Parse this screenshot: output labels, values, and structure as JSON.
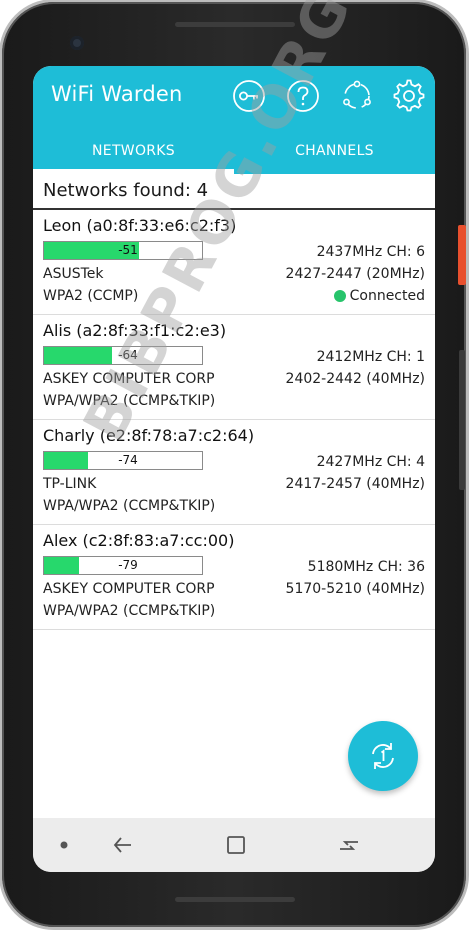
{
  "app": {
    "title": "WiFi Warden",
    "accent_color": "#1ebdd7",
    "toolbar_icons": [
      "key-icon",
      "help-icon",
      "share-icon",
      "settings-icon"
    ]
  },
  "tabs": [
    {
      "label": "NETWORKS",
      "selected": true
    },
    {
      "label": "CHANNELS",
      "selected": false
    }
  ],
  "summary": {
    "networks_found": "Networks found: 4"
  },
  "networks": [
    {
      "name": "Leon (a0:8f:33:e6:c2:f3)",
      "signal": "-51",
      "signal_fill": 0.6,
      "vendor": "ASUSTek",
      "security": "WPA2 (CCMP)",
      "frequency": "2437MHz  CH: 6",
      "range": "2427-2447 (20MHz)",
      "status": "Connected",
      "status_color": "#27c46b"
    },
    {
      "name": "Alis (a2:8f:33:f1:c2:e3)",
      "signal": "-64",
      "signal_fill": 0.43,
      "vendor": "ASKEY COMPUTER CORP",
      "security": "WPA/WPA2 (CCMP&TKIP)",
      "frequency": "2412MHz  CH: 1",
      "range": "2402-2442 (40MHz)",
      "status": ""
    },
    {
      "name": "Charly (e2:8f:78:a7:c2:64)",
      "signal": "-74",
      "signal_fill": 0.28,
      "vendor": "TP-LINK",
      "security": "WPA/WPA2 (CCMP&TKIP)",
      "frequency": "2427MHz  CH: 4",
      "range": "2417-2457 (40MHz)",
      "status": ""
    },
    {
      "name": "Alex (c2:8f:83:a7:cc:00)",
      "signal": "-79",
      "signal_fill": 0.22,
      "vendor": "ASKEY COMPUTER CORP",
      "security": "WPA/WPA2 (CCMP&TKIP)",
      "frequency": "5180MHz  CH: 36",
      "range": "5170-5210 (40MHz)",
      "status": ""
    }
  ],
  "fab": {
    "icon": "refresh-icon"
  },
  "system_nav": {
    "icons": [
      "dot-icon",
      "back-icon",
      "recents-icon",
      "overview-icon"
    ]
  },
  "watermark": {
    "text": "BIBPROG.ORG.UA"
  }
}
